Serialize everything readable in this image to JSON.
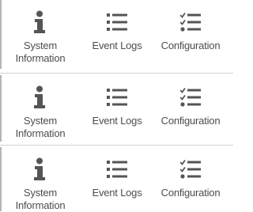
{
  "rows": [
    {
      "tiles": [
        {
          "label": "System Information",
          "icon": "info-icon"
        },
        {
          "label": "Event Logs",
          "icon": "list-icon"
        },
        {
          "label": "Configuration",
          "icon": "checklist-icon"
        }
      ]
    },
    {
      "tiles": [
        {
          "label": "System Information",
          "icon": "info-icon"
        },
        {
          "label": "Event Logs",
          "icon": "list-icon"
        },
        {
          "label": "Configuration",
          "icon": "checklist-icon"
        }
      ]
    },
    {
      "tiles": [
        {
          "label": "System Information",
          "icon": "info-icon"
        },
        {
          "label": "Event Logs",
          "icon": "list-icon"
        },
        {
          "label": "Configuration",
          "icon": "checklist-icon"
        }
      ]
    }
  ],
  "colors": {
    "icon": "#555555",
    "label": "#4d4d4d",
    "divider": "#d2d2d2",
    "edge": "#b5b5b5"
  }
}
